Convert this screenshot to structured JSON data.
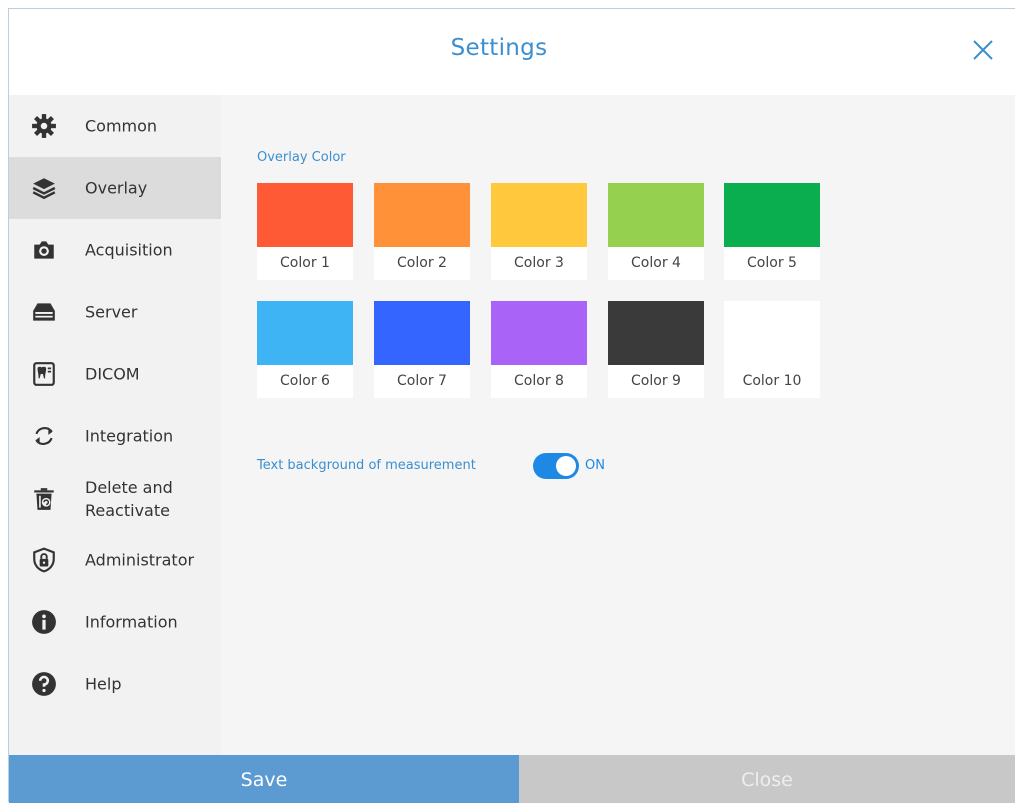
{
  "header": {
    "title": "Settings",
    "close_icon": "close-icon"
  },
  "sidebar": {
    "items": [
      {
        "label": "Common",
        "icon": "gear-icon"
      },
      {
        "label": "Overlay",
        "icon": "layers-icon",
        "active": true
      },
      {
        "label": "Acquisition",
        "icon": "camera-icon"
      },
      {
        "label": "Server",
        "icon": "server-icon"
      },
      {
        "label": "DICOM",
        "icon": "dicom-tooth-icon"
      },
      {
        "label": "Integration",
        "icon": "sync-icon"
      },
      {
        "label": "Delete and Reactivate",
        "icon": "trash-restore-icon"
      },
      {
        "label": "Administrator",
        "icon": "shield-lock-icon"
      },
      {
        "label": "Information",
        "icon": "info-icon"
      },
      {
        "label": "Help",
        "icon": "help-icon"
      }
    ]
  },
  "overlay": {
    "section_label": "Overlay Color",
    "colors": [
      {
        "label": "Color 1",
        "hex": "#ff5a36"
      },
      {
        "label": "Color 2",
        "hex": "#ff9138"
      },
      {
        "label": "Color 3",
        "hex": "#ffc83d"
      },
      {
        "label": "Color 4",
        "hex": "#95d14f"
      },
      {
        "label": "Color 5",
        "hex": "#0aae4f"
      },
      {
        "label": "Color 6",
        "hex": "#3fb4f5"
      },
      {
        "label": "Color 7",
        "hex": "#3466ff"
      },
      {
        "label": "Color 8",
        "hex": "#a964f7"
      },
      {
        "label": "Color 9",
        "hex": "#3a3a3a"
      },
      {
        "label": "Color 10",
        "hex": "#ffffff"
      }
    ],
    "text_background_label": "Text background of measurement",
    "text_background_state": "ON",
    "text_background_on": true
  },
  "footer": {
    "save_label": "Save",
    "close_label": "Close"
  },
  "colors": {
    "accent": "#3a8fd0",
    "toggle": "#1e88e5",
    "save": "#5b9bd1",
    "close": "#c8c8c8"
  }
}
